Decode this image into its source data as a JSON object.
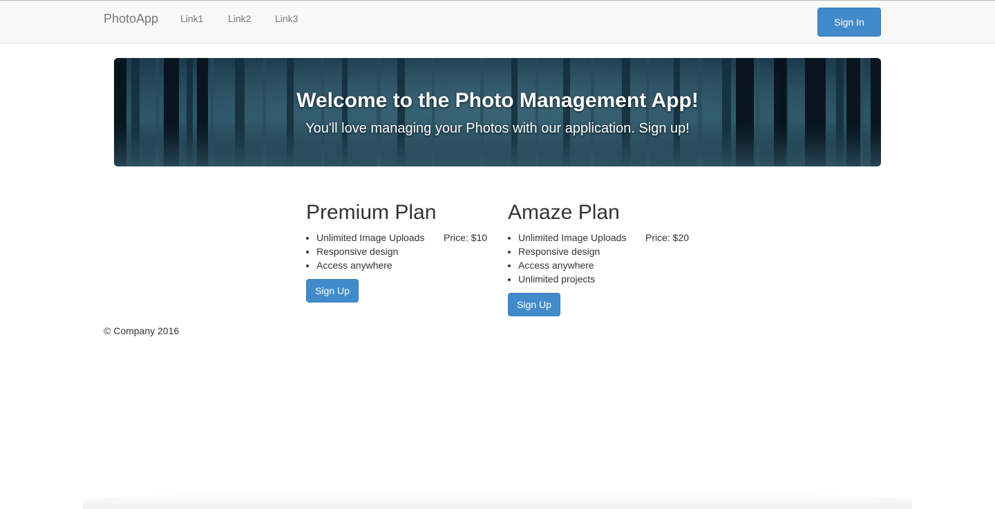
{
  "navbar": {
    "brand": "PhotoApp",
    "links": [
      "Link1",
      "Link2",
      "Link3"
    ],
    "sign_in_label": "Sign In"
  },
  "jumbotron": {
    "title": "Welcome to the Photo Management App!",
    "subtitle": "You'll love managing your Photos with our application. Sign up!"
  },
  "plans": [
    {
      "name": "Premium Plan",
      "price": "Price: $10",
      "features": [
        "Unlimited Image Uploads",
        "Responsive design",
        "Access anywhere"
      ],
      "button_label": "Sign Up"
    },
    {
      "name": "Amaze Plan",
      "price": "Price: $20",
      "features": [
        "Unlimited Image Uploads",
        "Responsive design",
        "Access anywhere",
        "Unlimited projects"
      ],
      "button_label": "Sign Up"
    }
  ],
  "footer": {
    "text": "© Company 2016"
  },
  "colors": {
    "primary": "#428bca",
    "navbar_bg": "#f8f8f8",
    "jumbotron_bg": "#1a3444"
  }
}
